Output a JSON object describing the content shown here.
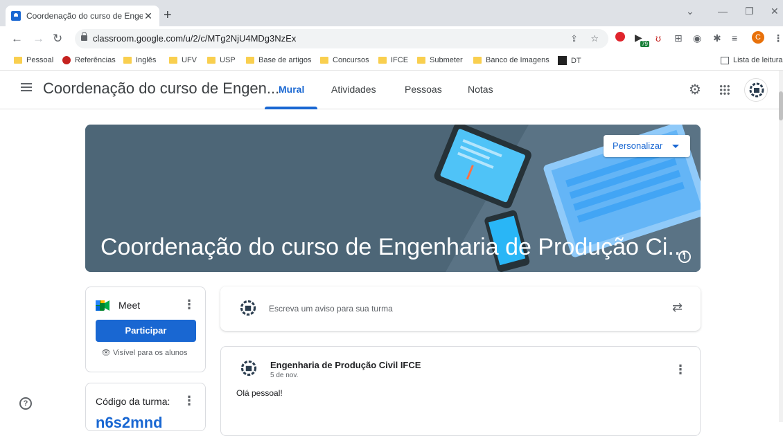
{
  "browser": {
    "tab_title": "Coordenação do curso de Engen",
    "address": "classroom.google.com/u/2/c/MTg2NjU4MDg3NzEx",
    "extension_badge": "79",
    "profile_initial": "C",
    "bookmarks": [
      "Pessoal",
      "Referências",
      "Inglês",
      "UFV",
      "USP",
      "Base de artigos",
      "Concursos",
      "IFCE",
      "Submeter",
      "Banco de Imagens",
      "DT"
    ],
    "reading_list": "Lista de leitura"
  },
  "header": {
    "class_name": "Coordenação do curso de Engen...",
    "tabs": [
      "Mural",
      "Atividades",
      "Pessoas",
      "Notas"
    ],
    "active_tab": "Mural"
  },
  "banner": {
    "title": "Coordenação do curso de Engenharia de Produção Ci...",
    "customize_label": "Personalizar",
    "bg_color": "#4d6677"
  },
  "meet": {
    "label": "Meet",
    "join_label": "Participar",
    "visibility": "Visível para os alunos"
  },
  "class_code": {
    "label": "Código da turma:",
    "value": "n6s2mnd"
  },
  "announce": {
    "placeholder": "Escreva um aviso para sua turma"
  },
  "post": {
    "author": "Engenharia de Produção Civil IFCE",
    "date": "5 de nov.",
    "body": "Olá pessoal!"
  },
  "icons": [
    "menu-icon",
    "settings-icon",
    "apps-grid-icon",
    "info-icon",
    "meet-icon",
    "more-vert-icon",
    "eye-icon",
    "repost-icon",
    "help-icon",
    "lock-icon"
  ],
  "colors": {
    "accent": "#1967d2",
    "text": "#202124",
    "muted": "#5f6368"
  }
}
